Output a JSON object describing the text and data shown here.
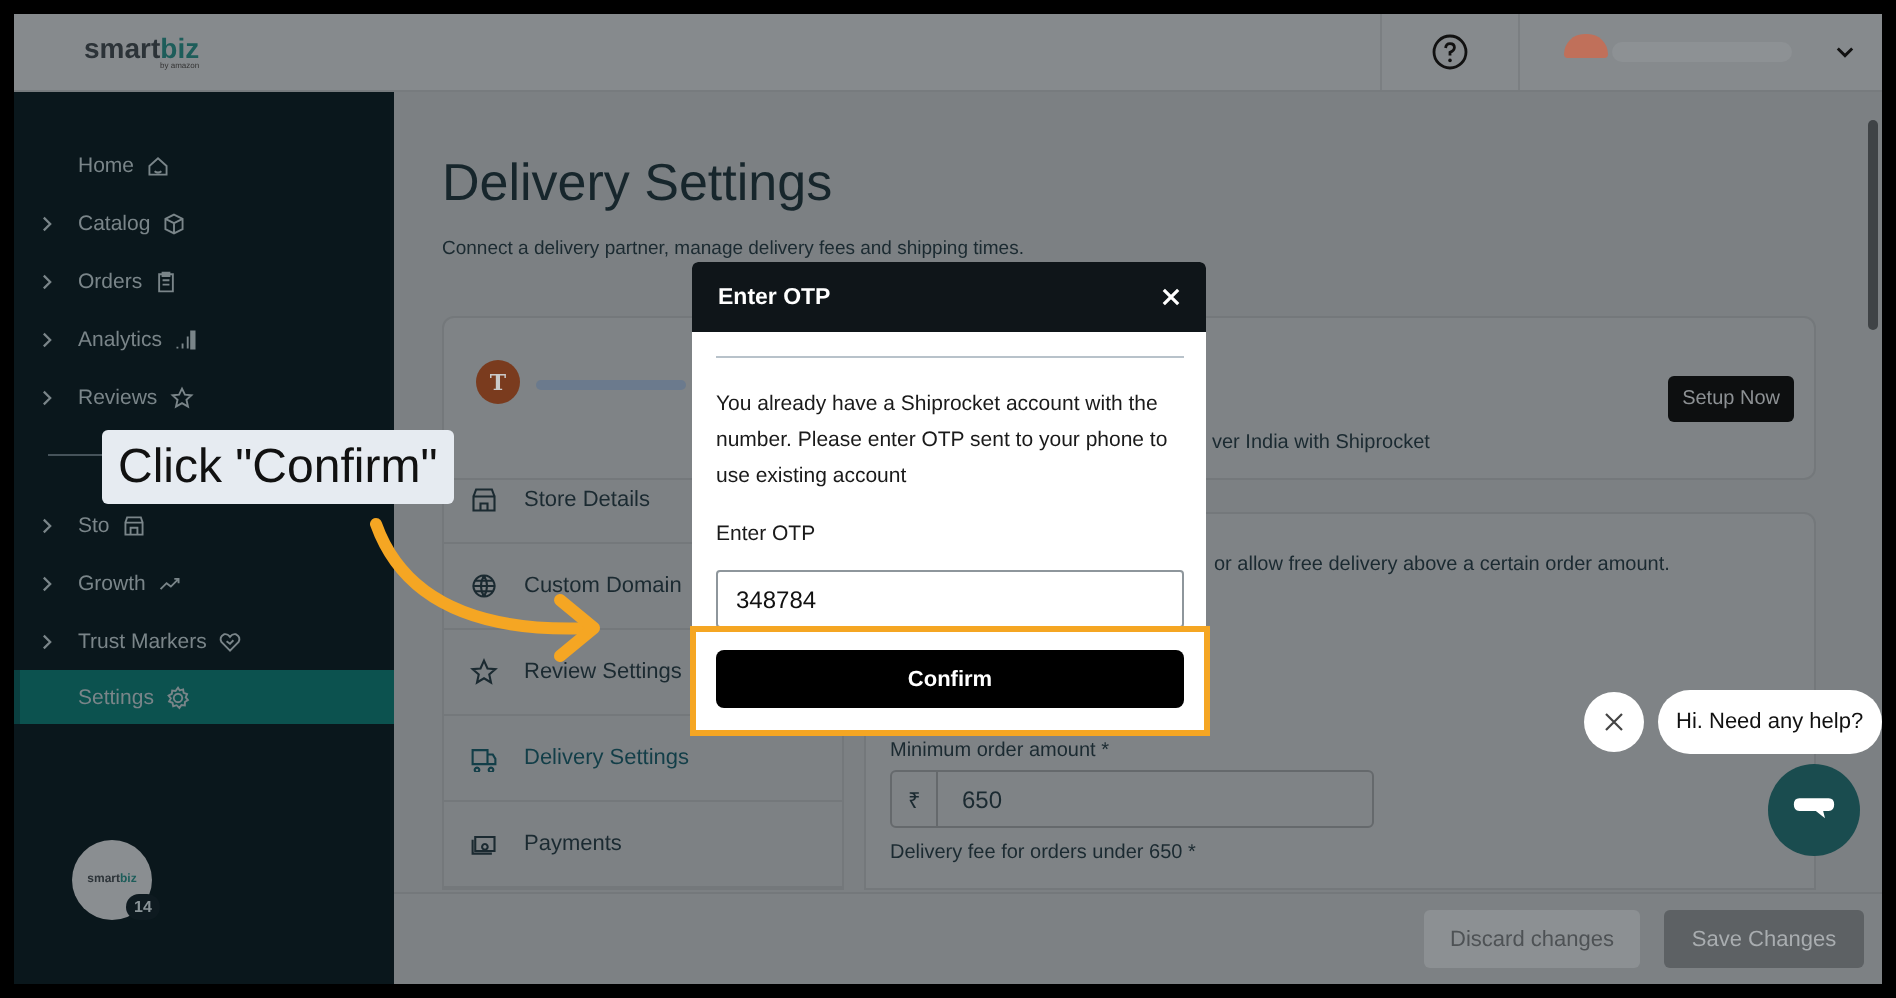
{
  "header": {
    "logo_primary": "smart",
    "logo_accent": "biz",
    "logo_tagline": "by amazon"
  },
  "sidebar": {
    "groups": [
      [
        {
          "label": "Home",
          "kind": "link",
          "selected": false
        },
        {
          "label": "Catalog",
          "kind": "group",
          "selected": false
        },
        {
          "label": "Orders",
          "kind": "group",
          "selected": false
        },
        {
          "label": "Analytics",
          "kind": "group",
          "selected": false
        },
        {
          "label": "Reviews",
          "kind": "group",
          "selected": false
        }
      ],
      [
        {
          "label": "Sto",
          "kind": "group",
          "selected": false
        },
        {
          "label": "Growth",
          "kind": "group",
          "selected": false
        },
        {
          "label": "Trust Markers",
          "kind": "group",
          "selected": false
        },
        {
          "label": "Settings",
          "kind": "link",
          "selected": true
        }
      ]
    ],
    "avatar_logo_primary": "smart",
    "avatar_logo_accent": "biz",
    "badge": "14"
  },
  "page": {
    "title": "Delivery Settings",
    "subtitle": "Connect a delivery partner, manage delivery fees and shipping times.",
    "partner_card": {
      "avatar_letter": "T",
      "text": "ver India with Shiprocket",
      "button": "Setup Now"
    },
    "settings_nav": [
      {
        "label": "Store Details",
        "selected": false
      },
      {
        "label": "Custom Domain",
        "selected": false
      },
      {
        "label": "Review Settings",
        "selected": false
      },
      {
        "label": "Delivery Settings",
        "selected": true
      },
      {
        "label": "Payments",
        "selected": false
      }
    ],
    "fee_card": {
      "text": "or allow free delivery above a certain order amount.",
      "min_label": "Minimum order amount *",
      "currency": "₹",
      "min_value": "650",
      "fee_label": "Delivery fee for orders under 650 *"
    },
    "footer": {
      "buttons": [
        {
          "label": "Discard changes",
          "kind": "secondary",
          "disabled": true
        },
        {
          "label": "Save Changes",
          "kind": "primary",
          "disabled": true
        }
      ]
    }
  },
  "modal": {
    "title": "Enter OTP",
    "message": "You already have a Shiprocket account with the number. Please enter OTP sent to your phone to use existing account",
    "field_label": "Enter OTP",
    "field_value": "348784",
    "confirm": "Confirm"
  },
  "callout": {
    "text": "Click \"Confirm\""
  },
  "chat": {
    "bubble": "Hi. Need any help?"
  }
}
